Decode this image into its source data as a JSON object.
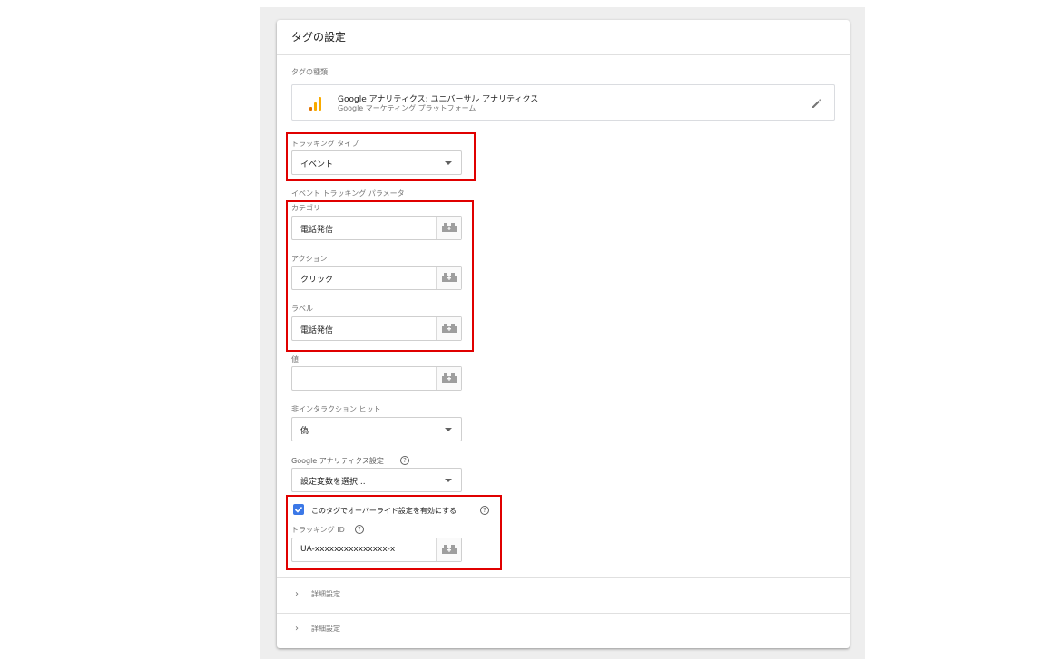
{
  "card": {
    "title": "タグの設定"
  },
  "tag_type": {
    "label": "タグの種類",
    "name": "Google アナリティクス: ユニバーサル アナリティクス",
    "subtitle": "Google マーケティング プラットフォーム",
    "logo_icon": "google-analytics-icon",
    "edit_icon": "pencil-icon"
  },
  "tracking_type": {
    "label": "トラッキング タイプ",
    "value": "イベント"
  },
  "event_params": {
    "section_label": "イベント トラッキング パラメータ",
    "category": {
      "label": "カテゴリ",
      "value": "電話発信"
    },
    "action": {
      "label": "アクション",
      "value": "クリック"
    },
    "event_label": {
      "label": "ラベル",
      "value": "電話発信"
    },
    "value": {
      "label": "値",
      "value": ""
    },
    "non_interaction": {
      "label": "非インタラクション ヒット",
      "value": "偽"
    }
  },
  "ga_settings": {
    "label": "Google アナリティクス設定",
    "value": "設定変数を選択..."
  },
  "override": {
    "checkbox_label": "このタグでオーバーライド設定を有効にする",
    "checked": true,
    "tracking_id_label": "トラッキング ID",
    "tracking_id_value": "UA-xxxxxxxxxxxxxxx-x"
  },
  "advanced": [
    {
      "label": "詳細設定"
    },
    {
      "label": "詳細設定"
    }
  ],
  "colors": {
    "accent": "#3b78e7",
    "highlight": "#e00000",
    "ga_orange": "#f9ab00",
    "ga_dark_orange": "#e37400"
  }
}
